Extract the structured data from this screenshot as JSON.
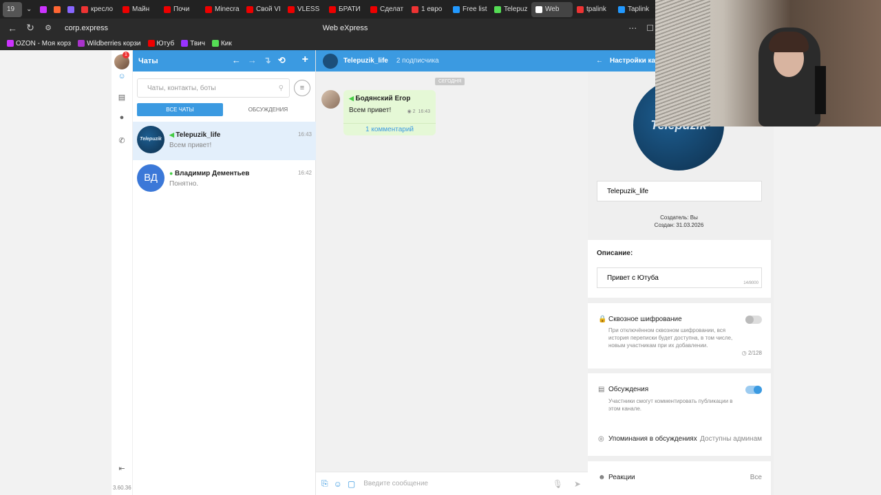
{
  "browser": {
    "tab_count": "19",
    "tabs": [
      "кресло",
      "Майн",
      "Почи",
      "Minecra",
      "Свой VI",
      "VLESS",
      "БРАТИ",
      "Сделат",
      "1 евро",
      "Free list",
      "Telepuz",
      "Web",
      "tpalink",
      "Taplink"
    ],
    "active_tab": "Web",
    "url": "corp.express",
    "page_title": "Web eXpress",
    "bookmarks": [
      "OZON - Моя корз",
      "Wildberries корзи",
      "Ютуб",
      "Твич",
      "Кик"
    ]
  },
  "rail": {
    "badge": "1",
    "version": "3.60.36"
  },
  "chatlist": {
    "title": "Чаты",
    "search_placeholder": "Чаты, контакты, боты",
    "tab_all": "ВСЕ ЧАТЫ",
    "tab_discussions": "ОБСУЖДЕНИЯ",
    "chats": [
      {
        "name": "Telepuzik_life",
        "message": "Всем привет!",
        "time": "16:43",
        "avatar_text": "Telepuzik"
      },
      {
        "name": "Владимир Дементьев",
        "message": "Понятно.",
        "time": "16:42",
        "avatar_text": "ВД"
      }
    ]
  },
  "conversation": {
    "channel_name": "Telepuzik_life",
    "subscribers": "2 подписчика",
    "date_label": "СЕГОДНЯ",
    "message": {
      "author": "Бодянский Егор",
      "text": "Всем привет!",
      "views": "2",
      "time": "16:43",
      "comments": "1 комментарий"
    },
    "composer_placeholder": "Введите сообщение"
  },
  "settings": {
    "title": "Настройки кан",
    "avatar_text": "Telepuzik",
    "channel_name": "Telepuzik_life",
    "creator": "Создатель: Вы",
    "created": "Создан: 31.03.2026",
    "description_label": "Описание:",
    "description": "Привет с Ютуба",
    "description_count": "14/8000",
    "e2e_label": "Сквозное шифрование",
    "e2e_desc": "При отключённом сквозном шифровании, вся история переписки будет доступна, в том числе, новым участникам при их добавлении.",
    "e2e_count": "2/128",
    "discussions_label": "Обсуждения",
    "discussions_desc": "Участники смогут комментировать публикации в этом канале.",
    "mentions_label": "Упоминания в обсуждениях",
    "mentions_value": "Доступны админам",
    "reactions_label": "Реакции",
    "reactions_value": "Все"
  },
  "colors": {
    "accent": "#3b9ae1",
    "bubble": "#e5f8d6"
  }
}
